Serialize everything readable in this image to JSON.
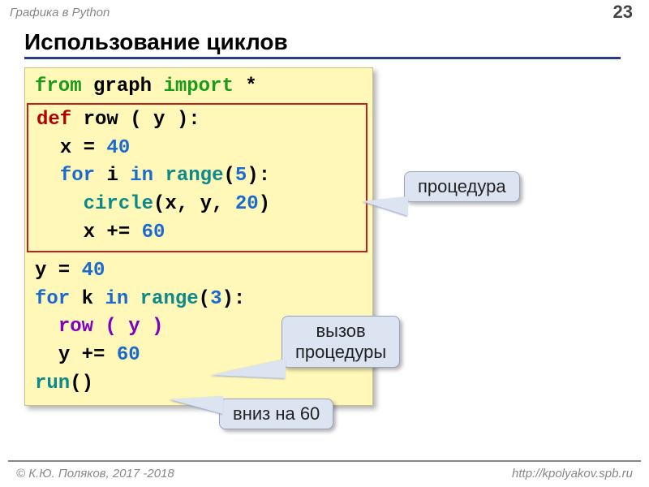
{
  "page": {
    "breadcrumb": "Графика в Python",
    "number": "23",
    "title": "Использование циклов"
  },
  "code": {
    "l1": {
      "a": "from",
      "b": "graph",
      "c": "import",
      "d": "*"
    },
    "l2": {
      "a": "def",
      "b": "row ( y ):"
    },
    "l3": {
      "a": "x = ",
      "b": "40"
    },
    "l4": {
      "a": "for",
      "b": "i",
      "c": "in",
      "d": "range",
      "e": "(",
      "f": "5",
      "g": "):"
    },
    "l5": {
      "a": "circle",
      "b": "(x, y, ",
      "c": "20",
      "d": ")"
    },
    "l6": {
      "a": "x += ",
      "b": "60"
    },
    "l7": {
      "a": "y = ",
      "b": "40"
    },
    "l8": {
      "a": "for",
      "b": "k",
      "c": "in",
      "d": "range",
      "e": "(",
      "f": "3",
      "g": "):"
    },
    "l9": {
      "a": "row ( y )"
    },
    "l10": {
      "a": "y += ",
      "b": "60"
    },
    "l11": {
      "a": "run",
      "b": "()"
    }
  },
  "callouts": {
    "procedure": "процедура",
    "call_line1": "вызов",
    "call_line2": "процедуры",
    "down": "вниз на 60"
  },
  "footer": {
    "left": "© К.Ю. Поляков, 2017 -2018",
    "right": "http://kpolyakov.spb.ru"
  }
}
